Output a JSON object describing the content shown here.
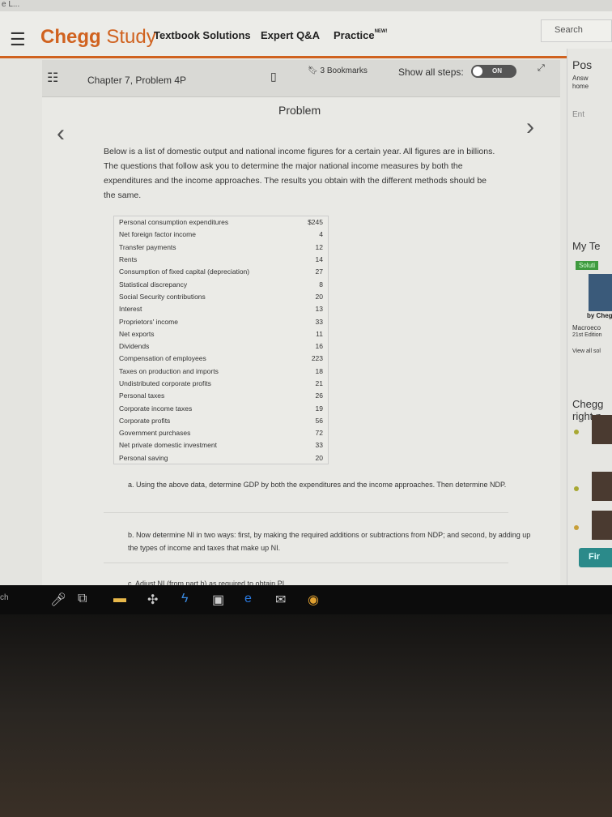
{
  "header": {
    "tab_text": "e L...",
    "logo_brand": "Chegg",
    "logo_product": "Study",
    "nav": [
      "Textbook Solutions",
      "Expert Q&A",
      "Practice"
    ],
    "new_badge": "NEW!",
    "search_placeholder": "Search"
  },
  "toolbar": {
    "chapter": "Chapter 7, Problem 4P",
    "bookmarks": "3 Bookmarks",
    "show_steps": "Show all steps:",
    "toggle": "ON"
  },
  "problem": {
    "title": "Problem",
    "intro": "Below is a list of domestic output and national income figures for a certain year. All figures are in billions. The questions that follow ask you to determine the major national income measures by both the expenditures and the income approaches. The results you obtain with the different methods should be the same.",
    "table": [
      [
        "Personal consumption expenditures",
        "$245"
      ],
      [
        "Net foreign factor income",
        "4"
      ],
      [
        "Transfer payments",
        "12"
      ],
      [
        "Rents",
        "14"
      ],
      [
        "Consumption of fixed capital (depreciation)",
        "27"
      ],
      [
        "Statistical discrepancy",
        "8"
      ],
      [
        "Social Security contributions",
        "20"
      ],
      [
        "Interest",
        "13"
      ],
      [
        "Proprietors' income",
        "33"
      ],
      [
        "Net exports",
        "11"
      ],
      [
        "Dividends",
        "16"
      ],
      [
        "Compensation of employees",
        "223"
      ],
      [
        "Taxes on production and imports",
        "18"
      ],
      [
        "Undistributed corporate profits",
        "21"
      ],
      [
        "Personal taxes",
        "26"
      ],
      [
        "Corporate income taxes",
        "19"
      ],
      [
        "Corporate profits",
        "56"
      ],
      [
        "Government purchases",
        "72"
      ],
      [
        "Net private domestic investment",
        "33"
      ],
      [
        "Personal saving",
        "20"
      ]
    ],
    "qa": "a. Using the above data, determine GDP by both the expenditures and the income approaches. Then determine NDP.",
    "qb": "b. Now determine NI in two ways: first, by making the required additions or subtractions from NDP; and second, by adding up the types of income and taxes that make up NI.",
    "qc": "c. Adjust NI (from part b) as required to obtain PI."
  },
  "sidebar": {
    "post": "Pos",
    "answ": "Answ",
    "home": "home",
    "ent": "Ent",
    "my_te": "My Te",
    "solut": "Soluti",
    "by": "by Chegg",
    "book": "Macroeco",
    "edition": "21st Edition",
    "view_all": "View all sol",
    "chegg": "Chegg",
    "right": "right n",
    "find": "Fir"
  },
  "taskbar": {
    "left_text": "ch"
  },
  "colors": {
    "accent": "#d0621f",
    "find_button": "#2b8a8a"
  }
}
